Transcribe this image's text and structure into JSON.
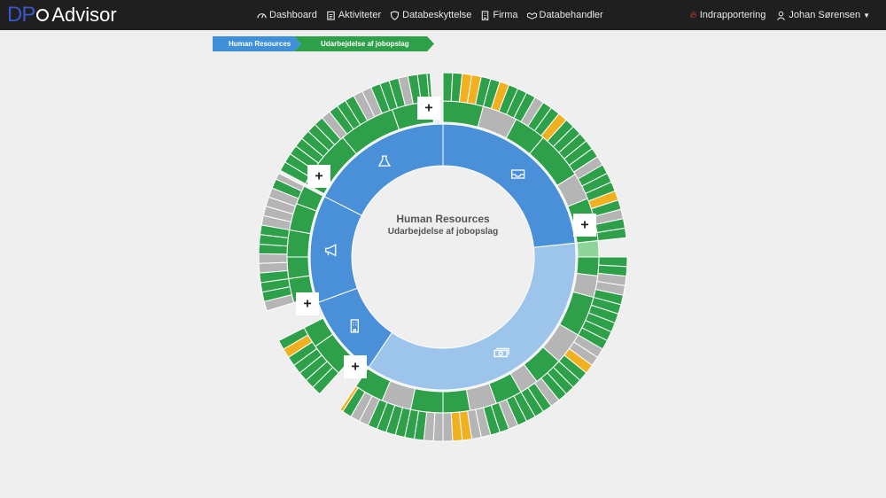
{
  "app": {
    "logo_dp": "DP",
    "logo_advisor": "Advisor"
  },
  "nav": [
    {
      "label": "Dashboard",
      "icon": "dashboard-icon"
    },
    {
      "label": "Aktiviteter",
      "icon": "clipboard-icon"
    },
    {
      "label": "Databeskyttelse",
      "icon": "shield-icon"
    },
    {
      "label": "Firma",
      "icon": "building-icon"
    },
    {
      "label": "Databehandler",
      "icon": "handshake-icon"
    }
  ],
  "header_right": {
    "report": "Indrapportering",
    "user": "Johan Sørensen"
  },
  "breadcrumb": [
    "Human Resources",
    "Udarbejdelse af jobopslag"
  ],
  "center": {
    "title": "Human Resources",
    "subtitle": "Udarbejdelse af jobopslag"
  },
  "colors": {
    "inner_blue": "#4a90d9",
    "inner_light": "#9dc5ec",
    "green": "#2fa04a",
    "gray": "#b5b5b5",
    "orange": "#f0b020",
    "white": "#ffffff",
    "topbar": "#1f1f1f"
  },
  "inner_ring": [
    {
      "name": "lab-segment",
      "icon": "flask-icon",
      "color": "blue"
    },
    {
      "name": "inbox-segment",
      "icon": "inbox-icon",
      "color": "blue"
    },
    {
      "name": "money-segment",
      "icon": "money-icon",
      "color": "light"
    },
    {
      "name": "building-segment",
      "icon": "building-icon",
      "color": "blue"
    },
    {
      "name": "megaphone-segment",
      "icon": "megaphone-icon",
      "color": "blue"
    }
  ],
  "add_buttons": [
    "+",
    "+",
    "+",
    "+",
    "+"
  ]
}
